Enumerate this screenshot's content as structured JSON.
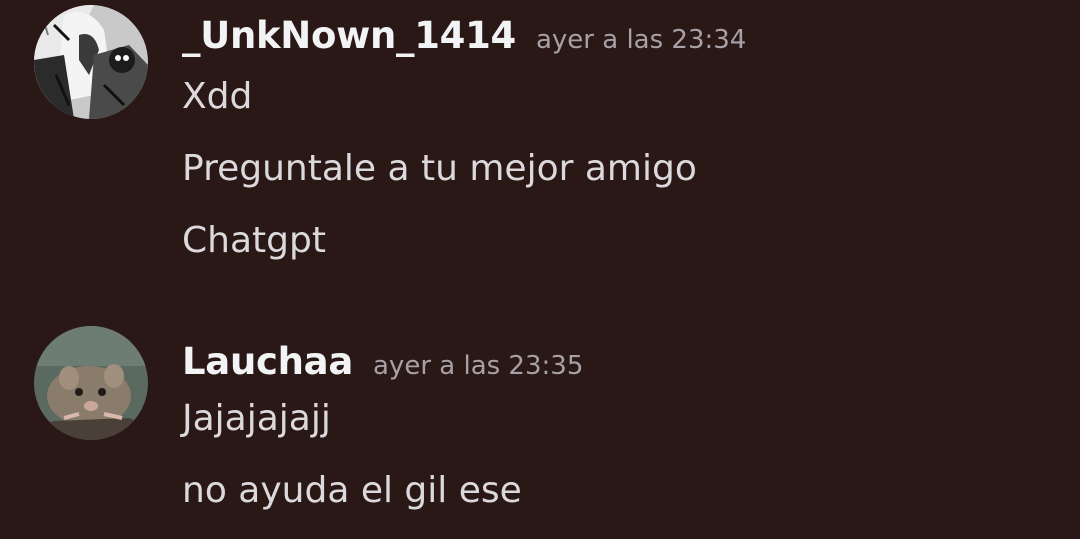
{
  "colors": {
    "background": "#2a1817",
    "username": "#f2f3f5",
    "timestamp": "#a7a0a5",
    "message_text": "#dcd9dc"
  },
  "messages": [
    {
      "author": "_UnkNown_1414",
      "timestamp": "ayer a las 23:34",
      "avatar_icon": "manga-character-avatar-icon",
      "lines": [
        "Xdd",
        "Preguntale a tu mejor amigo",
        "Chatgpt"
      ]
    },
    {
      "author": "Lauchaa",
      "timestamp": "ayer a las 23:35",
      "avatar_icon": "rat-avatar-icon",
      "lines": [
        "Jajajajajj",
        "no ayuda el gil ese"
      ]
    }
  ]
}
